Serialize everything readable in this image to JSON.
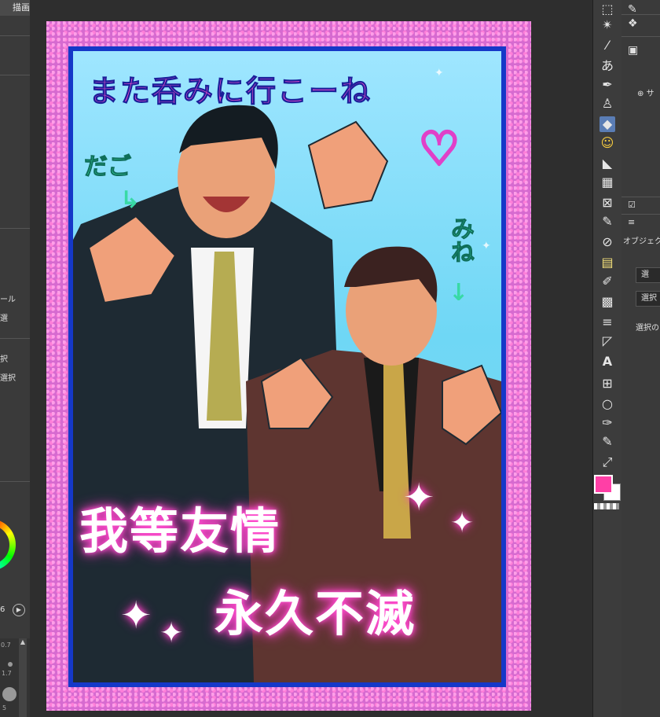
{
  "left_panel": {
    "top_label": "描画",
    "items": [
      "ール",
      "選",
      "択",
      "選択"
    ],
    "value_label": "6",
    "brush_sizes": [
      "0.7",
      "1",
      "1.7",
      "5"
    ]
  },
  "artwork": {
    "title": "また呑みに行こーね",
    "heart": "♡",
    "label_dago": "だご",
    "arrow_down_right": "↳",
    "label_mine": "みね",
    "arrow_down": "↓",
    "slogan_line1": "我等友情",
    "slogan_line2": "永久不滅",
    "sparkle_glyph": "✦"
  },
  "tools": {
    "text_tool_glyph": "あ",
    "text_tool_A": "A",
    "colors": {
      "main": "#ff3fa6",
      "sub": "#ffffff",
      "frame_border": "#1538c8",
      "frame_bg": "#d66ad0",
      "accent_pink": "#e249c9",
      "accent_green": "#38d9a5"
    }
  },
  "right_panel": {
    "object_label": "オブジェク",
    "btn_1": "選",
    "btn_2": "選択",
    "info_text": "選択の",
    "plus_text": "サ"
  }
}
